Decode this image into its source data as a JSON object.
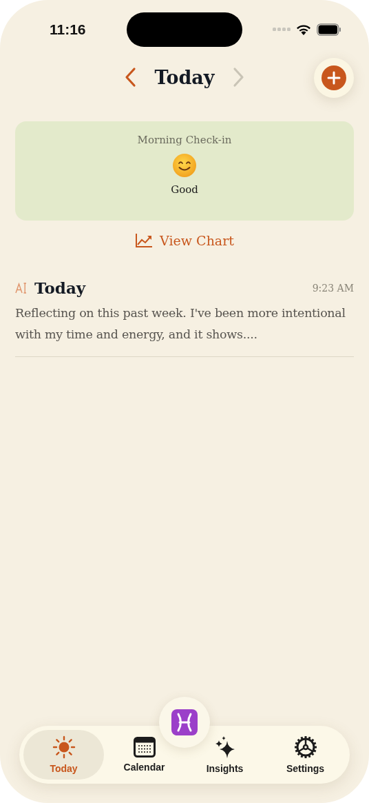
{
  "status_bar": {
    "time": "11:16"
  },
  "header": {
    "title": "Today",
    "prev_enabled": true,
    "next_enabled": false
  },
  "check_in": {
    "title": "Morning Check-in",
    "mood": "Good"
  },
  "chart_link": "View Chart",
  "entries": [
    {
      "title": "Today",
      "time": "9:23 AM",
      "text": "Reflecting on this past week. I've been more intentional with my time and energy, and it shows...."
    }
  ],
  "tabs": [
    {
      "label": "Today",
      "kind": "sun",
      "selected": true
    },
    {
      "label": "Calendar",
      "kind": "calendar",
      "selected": false
    },
    {
      "label": "Insights",
      "kind": "sparkles",
      "selected": false
    },
    {
      "label": "Settings",
      "kind": "gear",
      "selected": false
    }
  ]
}
